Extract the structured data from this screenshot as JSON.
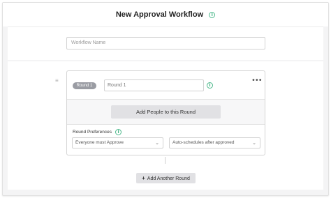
{
  "header": {
    "title": "New Approval Workflow"
  },
  "workflow": {
    "name_placeholder": "Workflow Name"
  },
  "round": {
    "badge": "Round 1",
    "name_value": "Round 1",
    "menu_glyph": "•••",
    "add_people_label": "Add People to this Round",
    "preferences_label": "Round Preferences",
    "approval_option": "Everyone must Approve",
    "schedule_option": "Auto-schedules after approved"
  },
  "actions": {
    "add_round_plus": "+",
    "add_round_label": "Add Another Round"
  },
  "colors": {
    "accent": "#4cb88b",
    "badge": "#9a9ca3",
    "button": "#e1e1e4"
  }
}
